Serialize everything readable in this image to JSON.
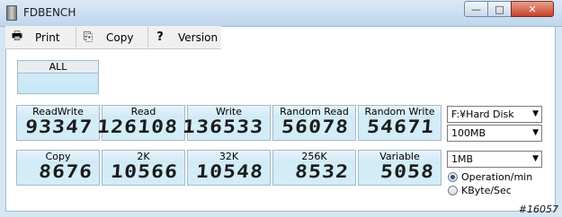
{
  "window": {
    "title": "FDBENCH",
    "minimize": "—",
    "maximize": "□",
    "close": "✕"
  },
  "toolbar": {
    "print": {
      "label": "Print",
      "icon": "printer-icon"
    },
    "copy": {
      "label": "Copy",
      "icon": "copy-icon"
    },
    "version": {
      "label": "Version",
      "icon": "question-icon"
    }
  },
  "all": {
    "label": "ALL",
    "value": ""
  },
  "row1": [
    {
      "label": "ReadWrite",
      "value": "93347"
    },
    {
      "label": "Read",
      "value": "126108"
    },
    {
      "label": "Write",
      "value": "136533"
    },
    {
      "label": "Random Read",
      "value": "56078"
    },
    {
      "label": "Random Write",
      "value": "54671"
    }
  ],
  "row2": [
    {
      "label": "Copy",
      "value": "8676"
    },
    {
      "label": "2K",
      "value": "10566"
    },
    {
      "label": "32K",
      "value": "10548"
    },
    {
      "label": "256K",
      "value": "8532"
    },
    {
      "label": "Variable",
      "value": "5058"
    }
  ],
  "controls": {
    "drive": "F:¥Hard Disk",
    "size": "100MB",
    "block": "1MB",
    "radio_ops": "Operation/min",
    "radio_kbyte": "KByte/Sec"
  },
  "watermark": "#16057"
}
